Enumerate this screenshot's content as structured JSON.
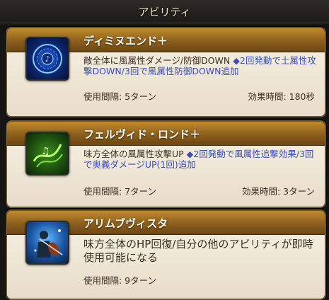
{
  "header": {
    "title": "アビリティ"
  },
  "abilities": [
    {
      "name": "ディミヌエンド＋",
      "desc": "敵全体に風属性ダメージ/防御DOWN",
      "bonus": "◆2回発動で土属性攻撃DOWN/3回で風属性防御DOWN追加",
      "cooldown": "使用間隔: 5ターン",
      "duration": "効果時間: 180秒",
      "icon": "blue-rune-circle-icon"
    },
    {
      "name": "フェルヴィド・ロンド＋",
      "desc": "味方全体の風属性攻撃UP",
      "bonus": "◆2回発動で風属性追撃効果/3回で奥義ダメージUP(1回)追加",
      "cooldown": "使用間隔: 7ターン",
      "duration": "効果時間: 3ターン",
      "icon": "green-music-wind-icon"
    },
    {
      "name": "アリムブヴィスタ",
      "desc": "味方全体のHP回復/自分の他のアビリティが即時使用可能になる",
      "cooldown": "使用間隔: 9ターン",
      "icon": "violinist-icon"
    }
  ],
  "colors": {
    "header_gold": "#a97526",
    "bonus_blue": "#3a4db8",
    "body_cream": "#efe6d4"
  }
}
